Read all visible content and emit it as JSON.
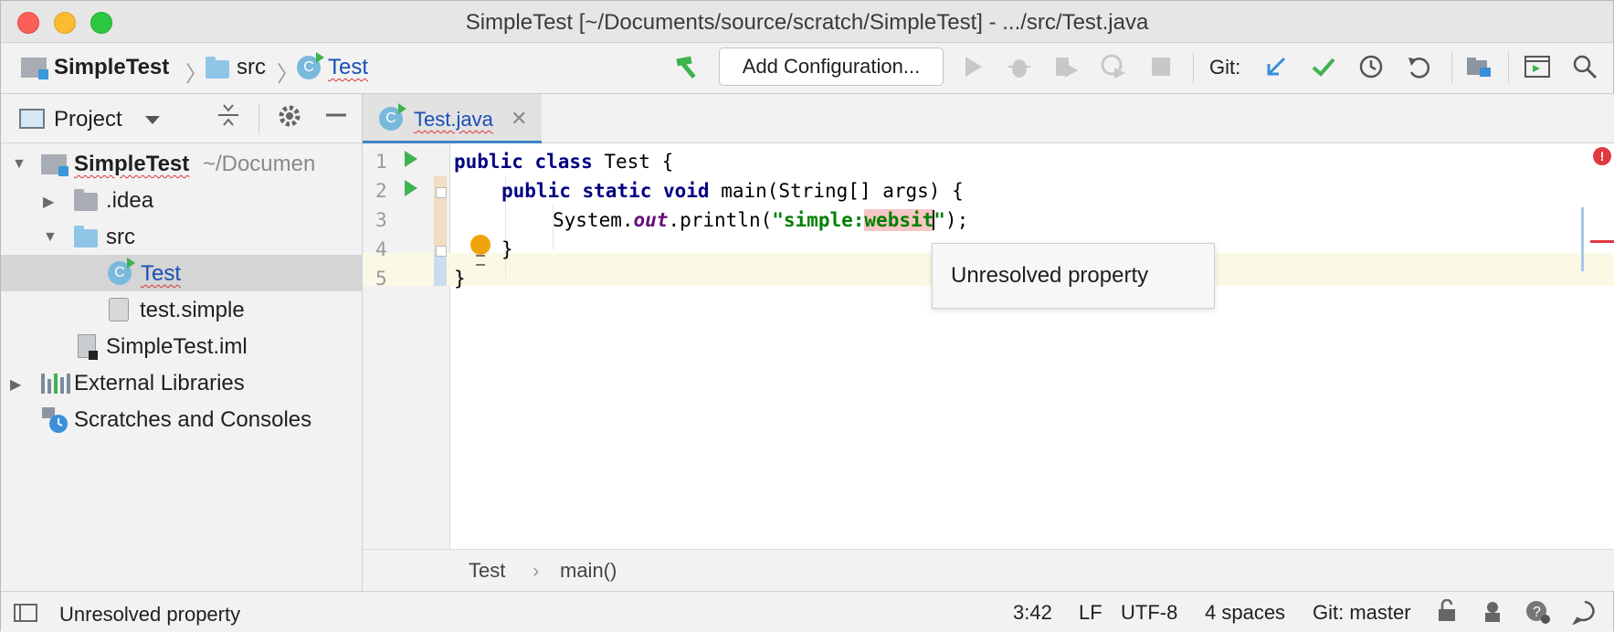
{
  "window": {
    "title": "SimpleTest [~/Documents/source/scratch/SimpleTest] - .../src/Test.java"
  },
  "navbar": {
    "crumbs": [
      {
        "label": "SimpleTest",
        "icon": "module-icon"
      },
      {
        "label": "src",
        "icon": "folder-icon"
      },
      {
        "label": "Test",
        "icon": "java-class-icon"
      }
    ],
    "build_icon": "hammer-icon",
    "add_configuration_label": "Add Configuration...",
    "run_icons": [
      "run-icon",
      "debug-icon",
      "run-with-coverage-icon",
      "profile-icon",
      "stop-icon"
    ],
    "git_label": "Git:",
    "git_icons": [
      "update-project-icon",
      "commit-icon",
      "history-icon",
      "rollback-icon"
    ],
    "right_icons": [
      "project-structure-icon",
      "terminal-icon",
      "search-everywhere-icon"
    ]
  },
  "project_panel": {
    "title": "Project",
    "tree": [
      {
        "label": "SimpleTest",
        "suffix": "~/Documen",
        "level": 0,
        "expanded": true
      },
      {
        "label": ".idea",
        "level": 1,
        "expanded": false
      },
      {
        "label": "src",
        "level": 1,
        "expanded": true
      },
      {
        "label": "Test",
        "level": 2,
        "selected": true
      },
      {
        "label": "test.simple",
        "level": 2
      },
      {
        "label": "SimpleTest.iml",
        "level": 1
      },
      {
        "label": "External Libraries",
        "level": 0,
        "expanded": false
      },
      {
        "label": "Scratches and Consoles",
        "level": 0
      }
    ]
  },
  "editor": {
    "tab_label": "Test.java",
    "line_numbers": [
      "1",
      "2",
      "3",
      "4",
      "5"
    ],
    "code": {
      "l1_kw": "public class",
      "l1_rest": " Test {",
      "l2_kw": "public static void",
      "l2_rest": " main(String[] args) {",
      "l3_pre": "System.",
      "l3_field": "out",
      "l3_mid": ".println(",
      "l3_str_a": "\"simple:",
      "l3_str_b": "websit",
      "l3_str_c": "\"",
      "l3_end": ");",
      "l4": "}",
      "l5": "}"
    },
    "tooltip": "Unresolved property",
    "breadcrumbs": [
      "Test",
      "main()"
    ],
    "breadcrumb_sep": "›"
  },
  "statusbar": {
    "message": "Unresolved property",
    "position": "3:42",
    "line_separator": "LF",
    "encoding": "UTF-8",
    "indent": "4 spaces",
    "git_branch": "Git: master"
  },
  "colors": {
    "keyword": "#000080",
    "string": "#008000",
    "field": "#660e7a",
    "error": "#e0393e",
    "tab_accent": "#4083c9"
  }
}
